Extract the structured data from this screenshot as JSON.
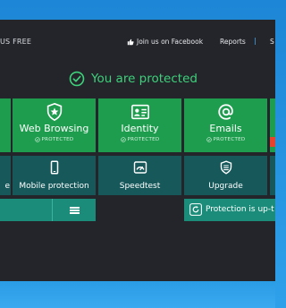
{
  "window": {
    "title_fragment": "US FREE"
  },
  "header": {
    "facebook_label": "Join us on Facebook",
    "reports_label": "Reports",
    "separator": "|",
    "settings_fragment": "S"
  },
  "status": {
    "text": "You are protected"
  },
  "tiles": [
    {
      "label": "Web Browsing",
      "status": "PROTECTED"
    },
    {
      "label": "Identity",
      "status": "PROTECTED"
    },
    {
      "label": "Emails",
      "status": "PROTECTED"
    }
  ],
  "row2": [
    {
      "label": "e"
    },
    {
      "label": "Mobile protection"
    },
    {
      "label": "Speedtest"
    },
    {
      "label": "Upgrade"
    }
  ],
  "update": {
    "text": "Protection is up-t"
  },
  "colors": {
    "background": "#23252b",
    "tile_green": "#1f9d4f",
    "status_green": "#3ed07a",
    "teal_tile": "#17595b",
    "bar_teal": "#1a8c79",
    "accent_red": "#e8412c",
    "desktop_blue": "#1d86d6"
  },
  "icons": [
    "facebook-like-icon",
    "check-circle-icon",
    "shield-star-icon",
    "id-card-icon",
    "at-sign-icon",
    "phone-icon",
    "speedometer-icon",
    "shield-upgrade-icon",
    "menu-icon",
    "refresh-icon"
  ]
}
